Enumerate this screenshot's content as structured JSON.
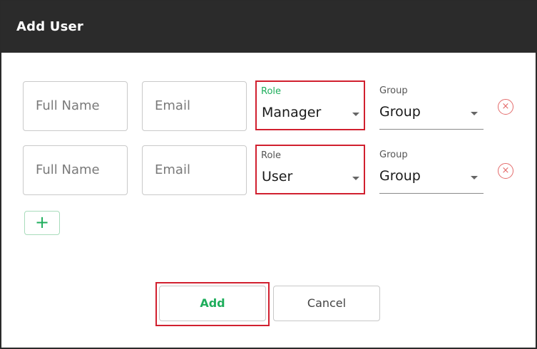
{
  "dialog": {
    "title": "Add User"
  },
  "rows": [
    {
      "full_name_placeholder": "Full Name",
      "email_placeholder": "Email",
      "role_label": "Role",
      "role_value": "Manager",
      "group_label": "Group",
      "group_value": "Group",
      "remove_glyph": "×"
    },
    {
      "full_name_placeholder": "Full Name",
      "email_placeholder": "Email",
      "role_label": "Role",
      "role_value": "User",
      "group_label": "Group",
      "group_value": "Group",
      "remove_glyph": "×"
    }
  ],
  "add_row_glyph": "+",
  "actions": {
    "add_label": "Add",
    "cancel_label": "Cancel"
  },
  "colors": {
    "accent": "#1fae5c",
    "highlight": "#d1202f",
    "remove": "#e46b6b",
    "titlebar": "#2b2b2b"
  }
}
